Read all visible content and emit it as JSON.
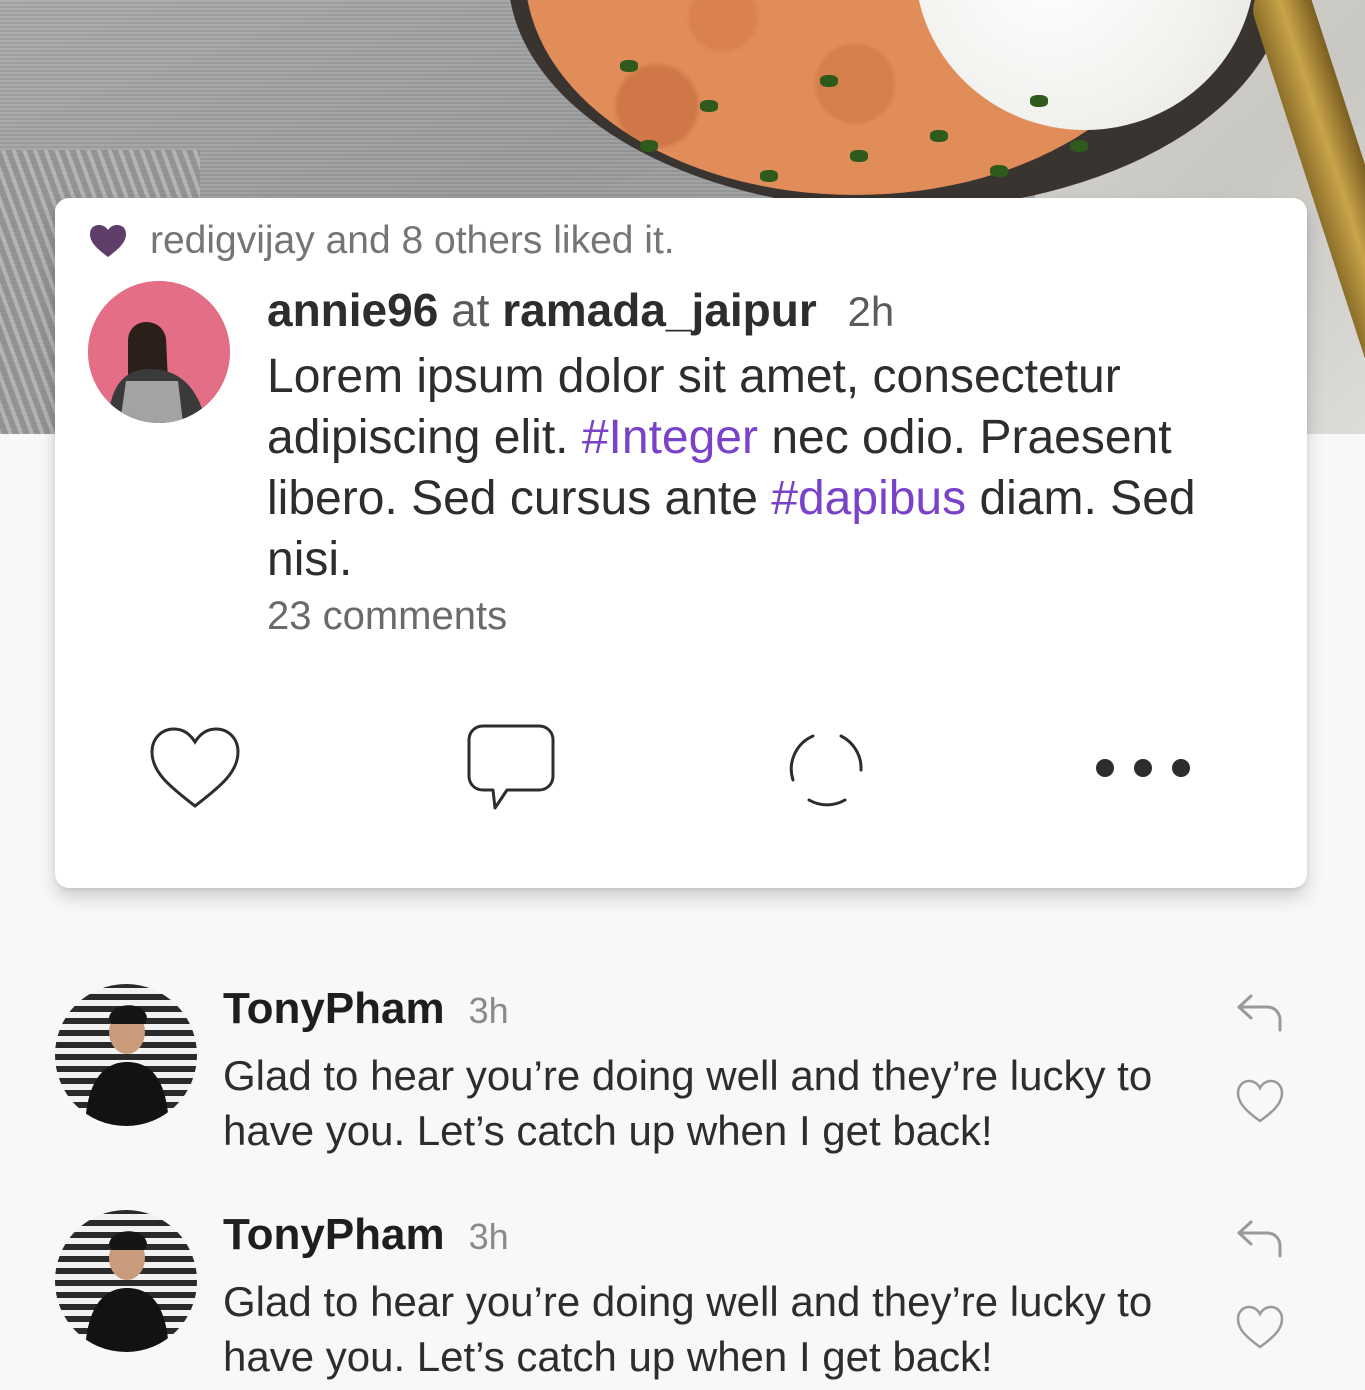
{
  "post": {
    "likes_text": "redigvijay and 8 others liked it.",
    "author": "annie96",
    "at_word": "at",
    "location": "ramada_jaipur",
    "time": "2h",
    "body": {
      "part1": "Lorem ipsum dolor sit amet, consectetur adipiscing elit. ",
      "hashtag1": "#Integer",
      "part2": " nec odio. Praesent libero. Sed cursus ante ",
      "hashtag2": "#dapibus",
      "part3": " diam. Sed nisi."
    },
    "comments_count": "23 comments",
    "actions": [
      "heart-icon",
      "comment-bubble-icon",
      "loading-spinner-icon",
      "more-options-icon"
    ]
  },
  "comments": [
    {
      "user": "TonyPham",
      "time": "3h",
      "text": "Glad to hear you’re doing well and they’re lucky to have you. Let’s catch up when I get back!"
    },
    {
      "user": "TonyPham",
      "time": "3h",
      "text": "Glad to hear you’re doing well and they’re lucky to have you. Let’s catch up when I get back!"
    }
  ],
  "colors": {
    "accent": "#7a42c9",
    "liked_heart": "#5e3f6a",
    "card_bg": "#ffffff",
    "page_bg": "#f8f8f8"
  }
}
